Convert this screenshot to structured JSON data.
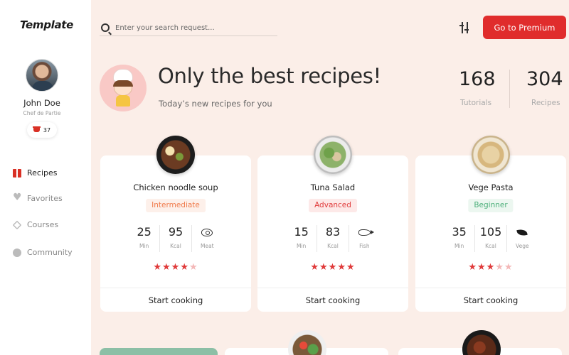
{
  "sidebar": {
    "logo": "Template",
    "user": {
      "name": "John Doe",
      "role": "Chef de Partie",
      "badge_count": "37"
    },
    "nav": [
      {
        "label": "Recipes",
        "icon": "book-icon",
        "active": true
      },
      {
        "label": "Favorites",
        "icon": "heart-icon",
        "active": false
      },
      {
        "label": "Courses",
        "icon": "layers-icon",
        "active": false
      },
      {
        "label": "Community",
        "icon": "globe-icon",
        "active": false
      }
    ]
  },
  "topbar": {
    "search_placeholder": "Enter your search request...",
    "premium_label": "Go to Premium"
  },
  "hero": {
    "title": "Only the best recipes!",
    "subtitle": "Today’s new recipes for you",
    "stats": [
      {
        "value": "168",
        "label": "Tutorials"
      },
      {
        "value": "304",
        "label": "Recipes"
      }
    ]
  },
  "cards": [
    {
      "title": "Chicken noodle soup",
      "level": "Intermediate",
      "level_color": "#f07a4a",
      "level_bg": "#fdf0ea",
      "time": "25",
      "time_unit": "Min",
      "kcal": "95",
      "kcal_unit": "Kcal",
      "tag": "Meat",
      "tag_icon": "meat-icon",
      "rating": 4,
      "button": "Start cooking"
    },
    {
      "title": "Tuna Salad",
      "level": "Advanced",
      "level_color": "#e03a3a",
      "level_bg": "#fde9e8",
      "time": "15",
      "time_unit": "Min",
      "kcal": "83",
      "kcal_unit": "Kcal",
      "tag": "Fish",
      "tag_icon": "fish-icon",
      "rating": 5,
      "button": "Start cooking"
    },
    {
      "title": "Vege Pasta",
      "level": "Beginner",
      "level_color": "#4caf7a",
      "level_bg": "#ecf7f0",
      "time": "35",
      "time_unit": "Min",
      "kcal": "105",
      "kcal_unit": "Kcal",
      "tag": "Vege",
      "tag_icon": "leaf-icon",
      "rating": 3,
      "button": "Start cooking"
    }
  ],
  "colors": {
    "accent": "#e02c2c",
    "star_on": "#e03a3a",
    "star_off": "#f4b8b8",
    "background": "#fbeee8"
  }
}
